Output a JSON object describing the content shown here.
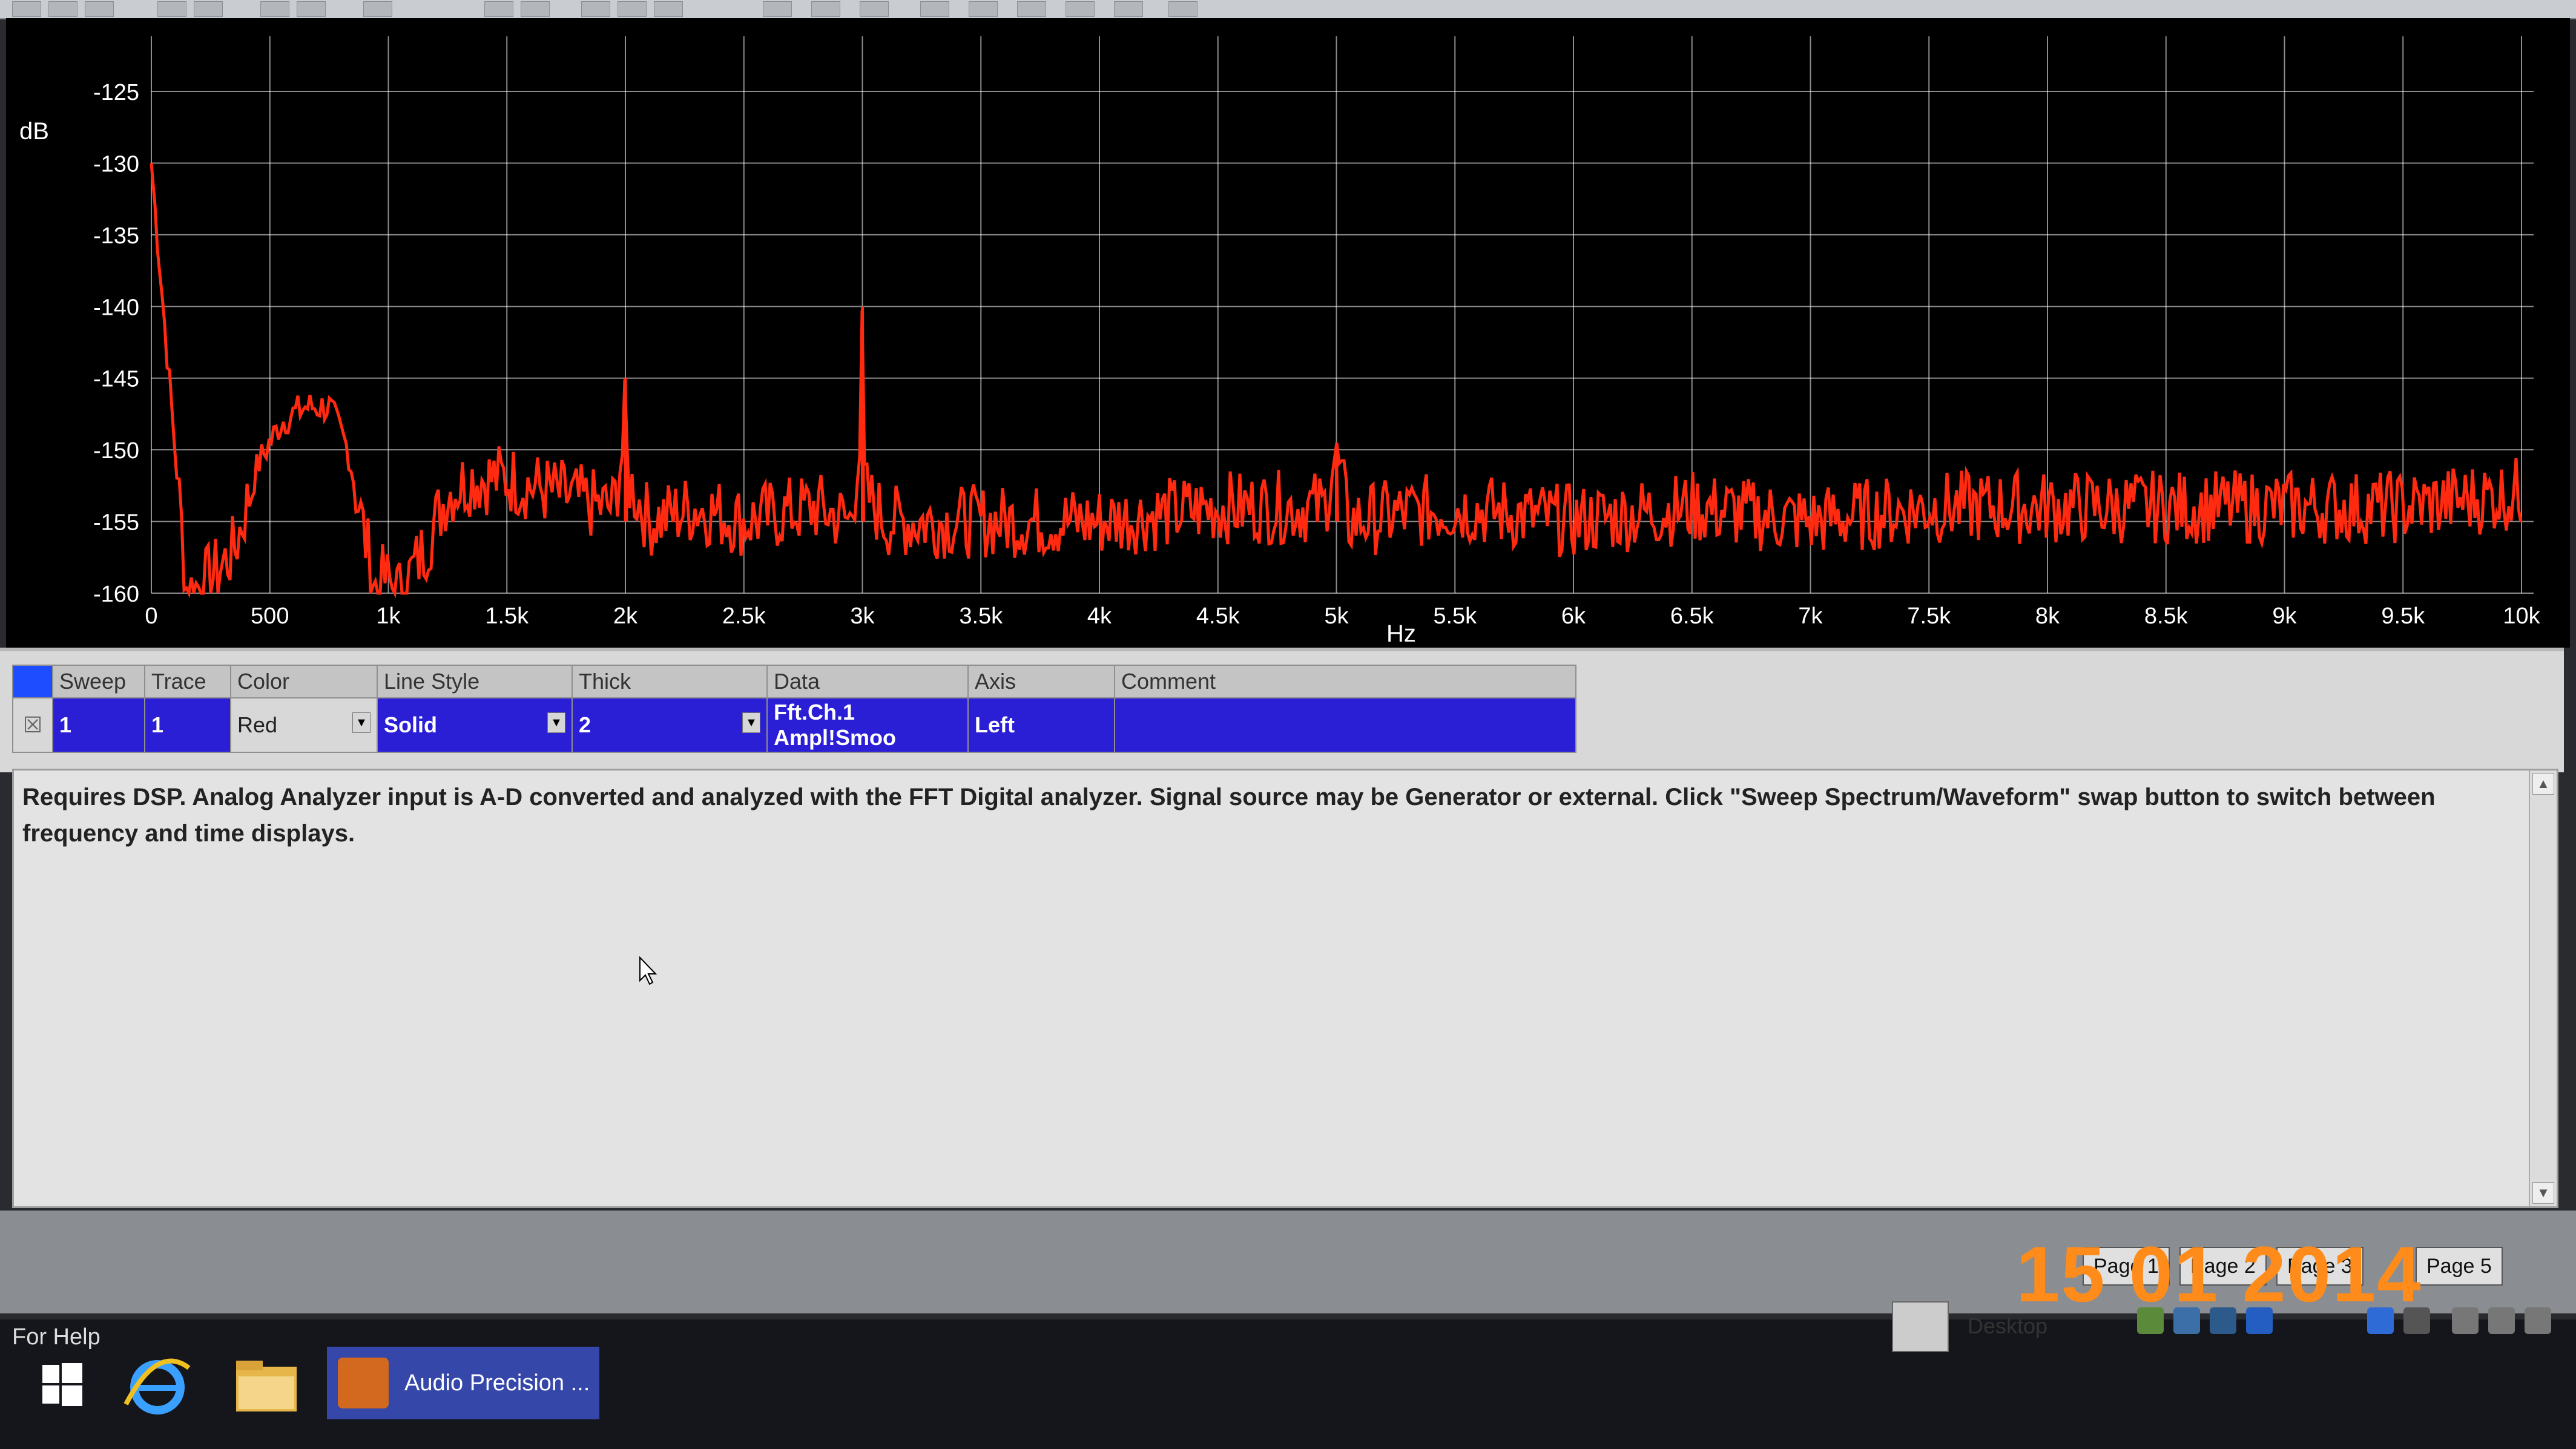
{
  "graph": {
    "y_unit_label": "dB",
    "x_unit_label": "Hz",
    "y_ticks": [
      "-125",
      "-130",
      "-135",
      "-140",
      "-145",
      "-150",
      "-155",
      "-160"
    ],
    "x_ticks": [
      "0",
      "500",
      "1k",
      "1.5k",
      "2k",
      "2.5k",
      "3k",
      "3.5k",
      "4k",
      "4.5k",
      "5k",
      "5.5k",
      "6k",
      "6.5k",
      "7k",
      "7.5k",
      "8k",
      "8.5k",
      "9k",
      "9.5k",
      "10k"
    ],
    "trace_color": "#ff2a10",
    "background_color": "#000000",
    "grid_color": "#ffffff"
  },
  "chart_data": {
    "type": "line",
    "xlabel": "Hz",
    "ylabel": "dB",
    "xlim": [
      0,
      10000
    ],
    "ylim": [
      -160,
      -122
    ],
    "grid": true,
    "series": [
      {
        "x": [
          0,
          150,
          250,
          350,
          450,
          550,
          650,
          750,
          830,
          900,
          950,
          980,
          1050,
          1150,
          1250,
          1350,
          1500,
          1700,
          1900,
          1950,
          1990,
          2000,
          2010,
          2100,
          2300,
          2500,
          2800,
          2950,
          2990,
          3000,
          3010,
          3100,
          3500,
          4000,
          4500,
          4950,
          5000,
          5050,
          5500,
          6000,
          6500,
          7000,
          7500,
          8000,
          8500,
          9000,
          9500,
          10000
        ],
        "y": [
          -130,
          -160,
          -159,
          -157,
          -151,
          -148,
          -147,
          -147,
          -150,
          -156,
          -160,
          -159,
          -160,
          -157,
          -153,
          -152,
          -152,
          -153,
          -154,
          -154,
          -150,
          -145,
          -152,
          -155,
          -154,
          -155,
          -154,
          -155,
          -150,
          -140,
          -153,
          -155,
          -155,
          -155,
          -154,
          -154,
          -150,
          -155,
          -154,
          -155,
          -154,
          -155,
          -154,
          -154,
          -154,
          -154,
          -154,
          -153
        ]
      }
    ]
  },
  "table": {
    "headers": [
      "Sweep",
      "Trace",
      "Color",
      "Line Style",
      "Thick",
      "Data",
      "Axis",
      "Comment"
    ],
    "row": {
      "sweep": "1",
      "trace": "1",
      "color": "Red",
      "line_style": "Solid",
      "thick": "2",
      "data": "Fft.Ch.1 Ampl!Smoo",
      "axis": "Left",
      "comment": ""
    }
  },
  "description": "Requires DSP. Analog Analyzer input is A-D converted and analyzed with the FFT Digital analyzer. Signal source may be Generator or external. Click \"Sweep Spectrum/Waveform\" swap button to switch between frequency and time displays.",
  "pages": [
    "Page 1",
    "Page 2",
    "Page 3",
    "Page 5"
  ],
  "date_stamp": "15 01 2014",
  "status": {
    "for_help": "For Help"
  },
  "taskbar": {
    "app_label": "Audio Precision ...",
    "desktop_label": "Desktop",
    "icons": [
      "windows-start-icon",
      "internet-explorer-icon",
      "file-explorer-icon",
      "audio-precision-icon"
    ]
  }
}
